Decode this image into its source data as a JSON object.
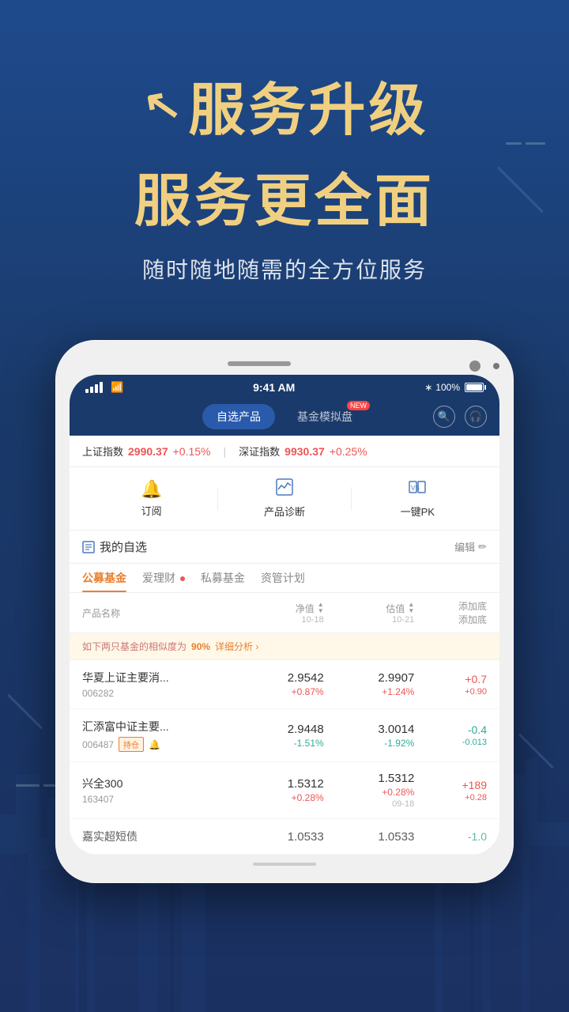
{
  "hero": {
    "title_line1_prefix": "↗",
    "title_line1": "服务升级",
    "title_line2": "服务更全面",
    "subtitle": "随时随地随需的全方位服务"
  },
  "phone": {
    "status_bar": {
      "time": "9:41 AM",
      "battery_percent": "100%",
      "signal": "●●●●"
    },
    "nav_tabs": [
      {
        "label": "自选产品",
        "active": true
      },
      {
        "label": "基金模拟盘",
        "active": false,
        "badge": "NEW"
      }
    ],
    "ticker": [
      {
        "label": "上证指数",
        "value": "2990.37",
        "change": "+0.15%"
      },
      {
        "label": "深证指数",
        "value": "9930.37",
        "change": "+0.25%"
      }
    ],
    "actions": [
      {
        "icon": "🔔",
        "label": "订阅"
      },
      {
        "icon": "📊",
        "label": "产品诊断"
      },
      {
        "icon": "⚔",
        "label": "一键PK"
      }
    ],
    "section": {
      "title": "我的自选",
      "edit_label": "编辑"
    },
    "fund_tabs": [
      {
        "label": "公募基金",
        "active": true
      },
      {
        "label": "爱理财",
        "dot": true,
        "active": false
      },
      {
        "label": "私募基金",
        "active": false
      },
      {
        "label": "资管计划",
        "active": false
      }
    ],
    "table_header": {
      "col_name": "产品名称",
      "col_nav": "净值",
      "col_nav_date": "10-18",
      "col_est": "估值",
      "col_est_date": "10-21",
      "col_add": "添加底",
      "col_add2": "添加底"
    },
    "similarity_notice": {
      "text": "如下两只基金的相似度为",
      "percent": "90%",
      "link": "详细分析 ›"
    },
    "funds": [
      {
        "name": "华夏上证主要消...",
        "code": "006282",
        "hold": false,
        "bell": false,
        "nav": "2.9542",
        "nav_change": "+0.87%",
        "nav_positive": true,
        "est": "2.9907",
        "est_change": "+1.24%",
        "est_positive": true,
        "add": "+0.7",
        "add_sub": "+0.90",
        "add_positive": true
      },
      {
        "name": "汇添富中证主要...",
        "code": "006487",
        "hold": true,
        "bell": true,
        "nav": "2.9448",
        "nav_change": "-1.51%",
        "nav_positive": false,
        "est": "3.0014",
        "est_change": "-1.92%",
        "est_positive": false,
        "add": "-0.4",
        "add_sub": "-0.013",
        "add_positive": false
      },
      {
        "name": "兴全300",
        "code": "163407",
        "hold": false,
        "bell": false,
        "nav": "1.5312",
        "nav_change": "+0.28%",
        "nav_positive": true,
        "est": "1.5312",
        "est_change": "+0.28%",
        "est_positive": true,
        "add": "+189",
        "add_sub": "+0.28",
        "add_positive": true,
        "date": "09-18"
      },
      {
        "name": "嘉实超短债",
        "code": "",
        "hold": false,
        "bell": false,
        "nav": "1.0533",
        "nav_change": "",
        "nav_positive": true,
        "est": "1.0533",
        "est_change": "",
        "est_positive": true,
        "add": "-1.0",
        "add_sub": "",
        "add_positive": false
      }
    ]
  },
  "colors": {
    "positive": "#e55555",
    "negative": "#33aa88",
    "accent": "#e88030",
    "navy": "#1a3a6b",
    "gold": "#f0d080"
  }
}
